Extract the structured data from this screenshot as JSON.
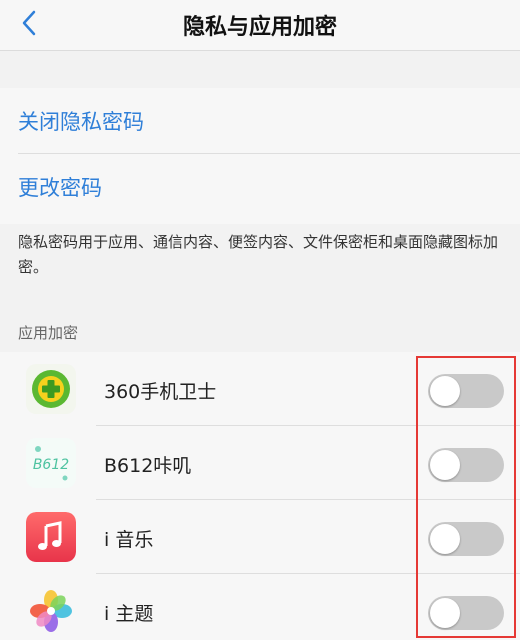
{
  "header": {
    "title": "隐私与应用加密",
    "back_icon": "chevron-left-icon"
  },
  "actions": {
    "close_privacy_password": "关闭隐私密码",
    "change_password": "更改密码"
  },
  "description": "隐私密码用于应用、通信内容、便签内容、文件保密柜和桌面隐藏图标加密。",
  "section": {
    "label": "应用加密"
  },
  "apps": [
    {
      "name": "360手机卫士",
      "icon": "360-security-icon",
      "enabled": false
    },
    {
      "name": "B612咔叽",
      "icon": "b612-icon",
      "enabled": false
    },
    {
      "name": "i 音乐",
      "icon": "music-note-icon",
      "enabled": false
    },
    {
      "name": "i 主题",
      "icon": "theme-flower-icon",
      "enabled": false
    }
  ],
  "colors": {
    "accent": "#2f7fd8",
    "toggle_off": "#c9c9c9",
    "highlight": "#e53935"
  }
}
